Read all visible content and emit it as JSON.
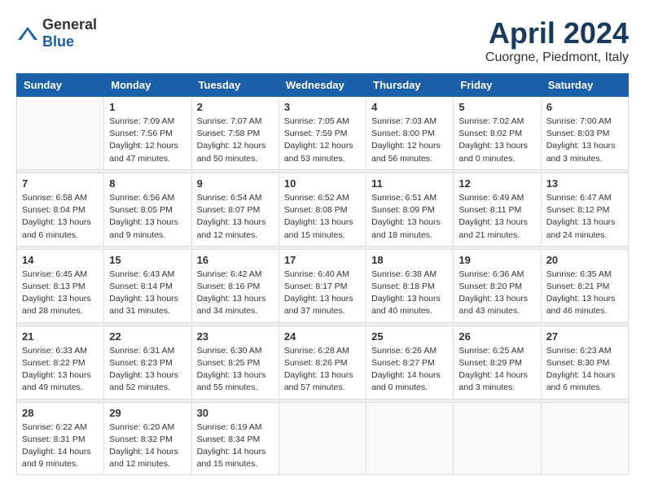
{
  "header": {
    "logo_general": "General",
    "logo_blue": "Blue",
    "title": "April 2024",
    "subtitle": "Cuorgne, Piedmont, Italy"
  },
  "days_header": [
    "Sunday",
    "Monday",
    "Tuesday",
    "Wednesday",
    "Thursday",
    "Friday",
    "Saturday"
  ],
  "weeks": [
    [
      {
        "day": "",
        "content": ""
      },
      {
        "day": "1",
        "content": "Sunrise: 7:09 AM\nSunset: 7:56 PM\nDaylight: 12 hours\nand 47 minutes."
      },
      {
        "day": "2",
        "content": "Sunrise: 7:07 AM\nSunset: 7:58 PM\nDaylight: 12 hours\nand 50 minutes."
      },
      {
        "day": "3",
        "content": "Sunrise: 7:05 AM\nSunset: 7:59 PM\nDaylight: 12 hours\nand 53 minutes."
      },
      {
        "day": "4",
        "content": "Sunrise: 7:03 AM\nSunset: 8:00 PM\nDaylight: 12 hours\nand 56 minutes."
      },
      {
        "day": "5",
        "content": "Sunrise: 7:02 AM\nSunset: 8:02 PM\nDaylight: 13 hours\nand 0 minutes."
      },
      {
        "day": "6",
        "content": "Sunrise: 7:00 AM\nSunset: 8:03 PM\nDaylight: 13 hours\nand 3 minutes."
      }
    ],
    [
      {
        "day": "7",
        "content": "Sunrise: 6:58 AM\nSunset: 8:04 PM\nDaylight: 13 hours\nand 6 minutes."
      },
      {
        "day": "8",
        "content": "Sunrise: 6:56 AM\nSunset: 8:05 PM\nDaylight: 13 hours\nand 9 minutes."
      },
      {
        "day": "9",
        "content": "Sunrise: 6:54 AM\nSunset: 8:07 PM\nDaylight: 13 hours\nand 12 minutes."
      },
      {
        "day": "10",
        "content": "Sunrise: 6:52 AM\nSunset: 8:08 PM\nDaylight: 13 hours\nand 15 minutes."
      },
      {
        "day": "11",
        "content": "Sunrise: 6:51 AM\nSunset: 8:09 PM\nDaylight: 13 hours\nand 18 minutes."
      },
      {
        "day": "12",
        "content": "Sunrise: 6:49 AM\nSunset: 8:11 PM\nDaylight: 13 hours\nand 21 minutes."
      },
      {
        "day": "13",
        "content": "Sunrise: 6:47 AM\nSunset: 8:12 PM\nDaylight: 13 hours\nand 24 minutes."
      }
    ],
    [
      {
        "day": "14",
        "content": "Sunrise: 6:45 AM\nSunset: 8:13 PM\nDaylight: 13 hours\nand 28 minutes."
      },
      {
        "day": "15",
        "content": "Sunrise: 6:43 AM\nSunset: 8:14 PM\nDaylight: 13 hours\nand 31 minutes."
      },
      {
        "day": "16",
        "content": "Sunrise: 6:42 AM\nSunset: 8:16 PM\nDaylight: 13 hours\nand 34 minutes."
      },
      {
        "day": "17",
        "content": "Sunrise: 6:40 AM\nSunset: 8:17 PM\nDaylight: 13 hours\nand 37 minutes."
      },
      {
        "day": "18",
        "content": "Sunrise: 6:38 AM\nSunset: 8:18 PM\nDaylight: 13 hours\nand 40 minutes."
      },
      {
        "day": "19",
        "content": "Sunrise: 6:36 AM\nSunset: 8:20 PM\nDaylight: 13 hours\nand 43 minutes."
      },
      {
        "day": "20",
        "content": "Sunrise: 6:35 AM\nSunset: 8:21 PM\nDaylight: 13 hours\nand 46 minutes."
      }
    ],
    [
      {
        "day": "21",
        "content": "Sunrise: 6:33 AM\nSunset: 8:22 PM\nDaylight: 13 hours\nand 49 minutes."
      },
      {
        "day": "22",
        "content": "Sunrise: 6:31 AM\nSunset: 8:23 PM\nDaylight: 13 hours\nand 52 minutes."
      },
      {
        "day": "23",
        "content": "Sunrise: 6:30 AM\nSunset: 8:25 PM\nDaylight: 13 hours\nand 55 minutes."
      },
      {
        "day": "24",
        "content": "Sunrise: 6:28 AM\nSunset: 8:26 PM\nDaylight: 13 hours\nand 57 minutes."
      },
      {
        "day": "25",
        "content": "Sunrise: 6:26 AM\nSunset: 8:27 PM\nDaylight: 14 hours\nand 0 minutes."
      },
      {
        "day": "26",
        "content": "Sunrise: 6:25 AM\nSunset: 8:29 PM\nDaylight: 14 hours\nand 3 minutes."
      },
      {
        "day": "27",
        "content": "Sunrise: 6:23 AM\nSunset: 8:30 PM\nDaylight: 14 hours\nand 6 minutes."
      }
    ],
    [
      {
        "day": "28",
        "content": "Sunrise: 6:22 AM\nSunset: 8:31 PM\nDaylight: 14 hours\nand 9 minutes."
      },
      {
        "day": "29",
        "content": "Sunrise: 6:20 AM\nSunset: 8:32 PM\nDaylight: 14 hours\nand 12 minutes."
      },
      {
        "day": "30",
        "content": "Sunrise: 6:19 AM\nSunset: 8:34 PM\nDaylight: 14 hours\nand 15 minutes."
      },
      {
        "day": "",
        "content": ""
      },
      {
        "day": "",
        "content": ""
      },
      {
        "day": "",
        "content": ""
      },
      {
        "day": "",
        "content": ""
      }
    ]
  ]
}
